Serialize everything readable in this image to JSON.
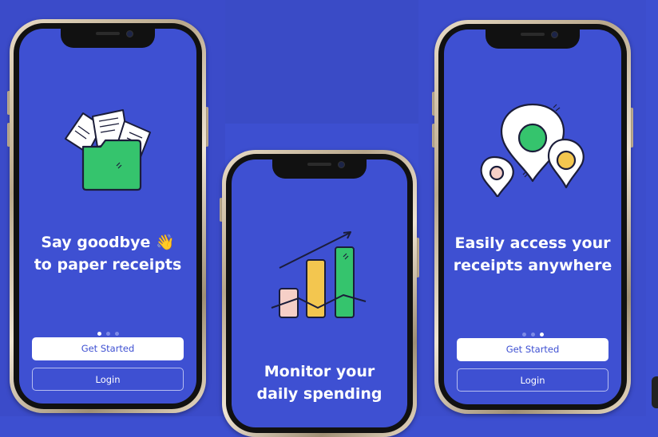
{
  "screens": [
    {
      "title_line1": "Say goodbye 👋",
      "title_line2": "to paper receipts",
      "illustration": "folder-with-papers-icon",
      "active_dot": 0,
      "primary_button": "Get Started",
      "secondary_button": "Login"
    },
    {
      "title_line1": "Monitor your",
      "title_line2": "daily spending",
      "illustration": "bar-chart-trend-icon",
      "active_dot": 1
    },
    {
      "title_line1": "Easily access your",
      "title_line2": "receipts anywhere",
      "illustration": "location-pins-icon",
      "active_dot": 2,
      "primary_button": "Get Started",
      "secondary_button": "Login"
    }
  ],
  "colors": {
    "background": "#3d4fd0",
    "screen": "#3e50d2",
    "green": "#35c46d",
    "yellow": "#f3c64f",
    "pink": "#f6cfc7",
    "button_text": "#3e50d2"
  }
}
